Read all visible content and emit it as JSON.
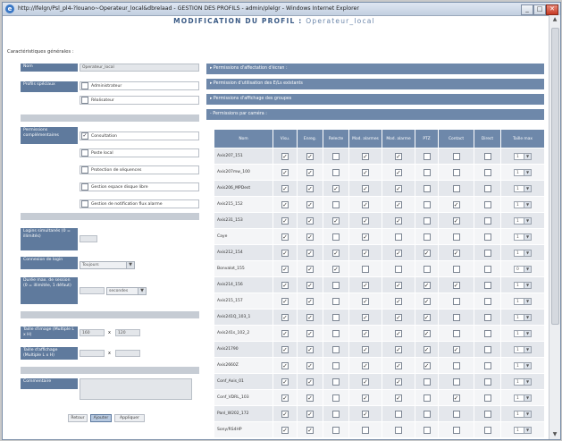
{
  "window": {
    "title": "http://lfelgn/Psl_pl4-?louano~Operateur_local&dbrelaad - GESTION DES PROFILS - admin/plelgr - Windows Internet Explorer",
    "minimize": "_",
    "maximize": "□",
    "close": "✕"
  },
  "page": {
    "title_main": "MODIFICATION DU PROFIL :",
    "title_profile": "Operateur_local",
    "section_caption": "Caractéristiques générales :"
  },
  "form": {
    "nom_label": "Nom",
    "nom_value": "Operateur_local",
    "profils_label": "Profils spéciaux",
    "profil_admin": "Administrateur",
    "profil_admin_checked": false,
    "profil_realisateur": "Réalisateur",
    "profil_realisateur_checked": false,
    "perm_label": "Permissions complémentaires",
    "perm_items": [
      {
        "label": "Consultation",
        "checked": true
      },
      {
        "label": "Poste local",
        "checked": false
      },
      {
        "label": "Protection de séquences",
        "checked": false
      },
      {
        "label": "Gestion espace disque libre",
        "checked": false
      },
      {
        "label": "Gestion de notification flux alarme",
        "checked": false
      }
    ],
    "logins_label": "Logins simultanés (0 = illimités)",
    "logins_value": "",
    "connexion_label": "Connexion de login",
    "connexion_value": "Toujours",
    "durée_label": "Durée max. de session (0 = illimitée, 1 défaut)",
    "durée_value": "",
    "durée_unit": "secondes",
    "taille_image_label": "Taille d'image (Multiple L x H)",
    "taille_image_w": "160",
    "taille_image_x": "x",
    "taille_image_h": "120",
    "taille_affichage_label": "Taille d'affichage (Multiple L x H)",
    "taille_affichage_w": "",
    "taille_affichage_x": "x",
    "taille_affichage_h": "",
    "commentaire_label": "Commentaire",
    "commentaire_value": "",
    "btn_retour": "Retour",
    "btn_ajouter": "Ajouter",
    "btn_appliquer": "Appliquer"
  },
  "panels": {
    "bar1": "▸ Permissions d'affectation d'écran :",
    "bar2": "▸ Permission d'utilisation des E/Ls existants",
    "bar3": "▸ Permissions d'affichage des groupes",
    "bar4": "- Permissions par caméra :"
  },
  "table": {
    "headers": [
      "Nom",
      "Visu.",
      "Enreg.",
      "Relecte",
      "Mod. alarmes",
      "Mod. alarme",
      "PTZ",
      "Contact",
      "Direct",
      "Taille max"
    ],
    "rows": [
      {
        "name": "Axis207_151",
        "checks": [
          true,
          true,
          false,
          true,
          true,
          false,
          false,
          false
        ],
        "level": "1"
      },
      {
        "name": "Axis207mw_100",
        "checks": [
          true,
          true,
          false,
          true,
          true,
          false,
          false,
          false
        ],
        "level": "1"
      },
      {
        "name": "Axis206_MPDest",
        "checks": [
          true,
          true,
          true,
          true,
          true,
          false,
          false,
          false
        ],
        "level": "1"
      },
      {
        "name": "Axis215_152",
        "checks": [
          true,
          true,
          false,
          true,
          true,
          false,
          true,
          false
        ],
        "level": "1"
      },
      {
        "name": "Axis231_153",
        "checks": [
          true,
          true,
          true,
          true,
          true,
          false,
          true,
          false
        ],
        "level": "1"
      },
      {
        "name": "Caye",
        "checks": [
          true,
          true,
          false,
          true,
          false,
          false,
          false,
          false
        ],
        "level": "1"
      },
      {
        "name": "Axis212_154",
        "checks": [
          true,
          true,
          true,
          true,
          true,
          true,
          true,
          false
        ],
        "level": "1"
      },
      {
        "name": "Bonvalot_155",
        "checks": [
          true,
          true,
          true,
          false,
          false,
          false,
          false,
          false
        ],
        "level": "0"
      },
      {
        "name": "Axis214_156",
        "checks": [
          true,
          true,
          false,
          true,
          true,
          true,
          true,
          false
        ],
        "level": "1"
      },
      {
        "name": "Axis215_157",
        "checks": [
          true,
          true,
          false,
          true,
          true,
          true,
          false,
          false
        ],
        "level": "1"
      },
      {
        "name": "Axis241Q_103_1",
        "checks": [
          true,
          true,
          false,
          true,
          true,
          true,
          false,
          false
        ],
        "level": "1"
      },
      {
        "name": "Axis241s_102_2",
        "checks": [
          true,
          true,
          false,
          true,
          true,
          true,
          false,
          false
        ],
        "level": "1"
      },
      {
        "name": "Axis21790",
        "checks": [
          true,
          true,
          false,
          true,
          true,
          true,
          true,
          false
        ],
        "level": "1"
      },
      {
        "name": "Axis2660Z",
        "checks": [
          true,
          true,
          false,
          true,
          true,
          true,
          false,
          false
        ],
        "level": "1"
      },
      {
        "name": "Conf_Axis_01",
        "checks": [
          true,
          true,
          false,
          true,
          true,
          false,
          false,
          false
        ],
        "level": "1"
      },
      {
        "name": "Conf_VDRL_103",
        "checks": [
          true,
          true,
          false,
          true,
          true,
          false,
          true,
          false
        ],
        "level": "1"
      },
      {
        "name": "Panl_W202_172",
        "checks": [
          true,
          true,
          false,
          true,
          false,
          false,
          false,
          false
        ],
        "level": "1"
      },
      {
        "name": "Sony/RS4HP",
        "checks": [
          true,
          true,
          false,
          false,
          false,
          false,
          false,
          false
        ],
        "level": "1"
      }
    ]
  }
}
